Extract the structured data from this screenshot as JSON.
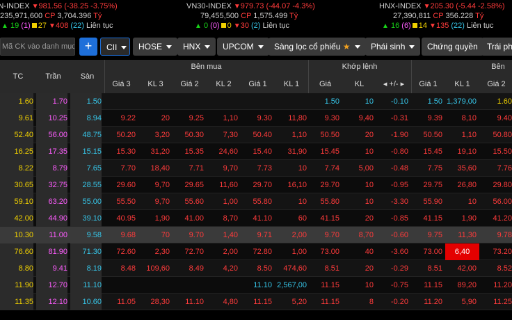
{
  "indices": [
    {
      "name": "VN-INDEX",
      "value": "981.56",
      "change": "(-38.25 -3.75%)",
      "volume": "235,971,600",
      "cp_label": "CP",
      "cp_value": "3,704.396",
      "unit": "Tỷ",
      "up_count": "19",
      "up_ceiling": "(1)",
      "ref_count": "27",
      "down_count": "408",
      "down_floor": "(22)",
      "session": "Liên tục"
    },
    {
      "name": "VN30-INDEX",
      "value": "979.73",
      "change": "(-44.07 -4.3%)",
      "volume": "79,455,500",
      "cp_label": "CP",
      "cp_value": "1,575.499",
      "unit": "Tỷ",
      "up_count": "0",
      "up_ceiling": "(0)",
      "ref_count": "0",
      "down_count": "30",
      "down_floor": "(2)",
      "session": "Liên tục"
    },
    {
      "name": "HNX-INDEX",
      "value": "205.30",
      "change": "(-5.44 -2.58%)",
      "volume": "27,390,811",
      "cp_label": "CP",
      "cp_value": "356.228",
      "unit": "Tỷ",
      "up_count": "16",
      "up_ceiling": "(6)",
      "ref_count": "14",
      "down_count": "135",
      "down_floor": "(22)",
      "session": "Liên tục"
    }
  ],
  "toolbar": {
    "search_placeholder": "Mã CK vào danh mục",
    "add_label": "+",
    "watchlist": "CII",
    "exchanges": [
      "HOSE",
      "HNX",
      "UPCOM"
    ],
    "filter": "Sàng lọc cổ phiếu",
    "derivatives": "Phái sinh",
    "warrants": "Chứng quyền",
    "bonds": "Trái ph"
  },
  "header": {
    "tc": "TC",
    "tran": "Trần",
    "san": "Sàn",
    "buy_group": "Bên mua",
    "match_group": "Khớp lệnh",
    "sell_group": "Bên",
    "buy_cols": [
      "Giá 3",
      "KL 3",
      "Giá 2",
      "KL 2",
      "Giá 1",
      "KL 1"
    ],
    "match_cols": [
      "Giá",
      "KL",
      "+/-"
    ],
    "sell_cols": [
      "Giá 1",
      "KL 1",
      "Giá 2"
    ]
  },
  "rows": [
    {
      "tc": "1.60",
      "tran": "1.70",
      "san": "1.50",
      "g3": "",
      "k3": "",
      "g2": "",
      "k2": "",
      "g1": "",
      "k1": "",
      "mp": "1.50",
      "mk": "10",
      "mc": "-0.10",
      "s1": "1.50",
      "sk1": "1,379,00",
      "s2": "1.60",
      "st": "floor",
      "bc": [
        "",
        "",
        ""
      ],
      "mcls": "floor",
      "sc": [
        "floor",
        "floor",
        "ref"
      ]
    },
    {
      "tc": "9.61",
      "tran": "10.25",
      "san": "8.94",
      "g3": "9.22",
      "k3": "20",
      "g2": "9.25",
      "k2": "1,10",
      "g1": "9.30",
      "k1": "11,80",
      "mp": "9.30",
      "mk": "9,40",
      "mc": "-0.31",
      "s1": "9.39",
      "sk1": "8,10",
      "s2": "9.40",
      "bc": [
        "dn",
        "dn",
        "dn"
      ],
      "mcls": "dn",
      "sc": [
        "dn",
        "dn",
        "dn"
      ]
    },
    {
      "tc": "52.40",
      "tran": "56.00",
      "san": "48.75",
      "g3": "50.20",
      "k3": "3,20",
      "g2": "50.30",
      "k2": "7,30",
      "g1": "50.40",
      "k1": "1,10",
      "mp": "50.50",
      "mk": "20",
      "mc": "-1.90",
      "s1": "50.50",
      "sk1": "1,10",
      "s2": "50.80",
      "bc": [
        "dn",
        "dn",
        "dn"
      ],
      "mcls": "dn",
      "sc": [
        "dn",
        "dn",
        "dn"
      ]
    },
    {
      "tc": "16.25",
      "tran": "17.35",
      "san": "15.15",
      "g3": "15.30",
      "k3": "31,20",
      "g2": "15.35",
      "k2": "24,60",
      "g1": "15.40",
      "k1": "31,90",
      "mp": "15.45",
      "mk": "10",
      "mc": "-0.80",
      "s1": "15.45",
      "sk1": "19,10",
      "s2": "15.50",
      "bc": [
        "dn",
        "dn",
        "dn"
      ],
      "mcls": "dn",
      "sc": [
        "dn",
        "dn",
        "dn"
      ]
    },
    {
      "tc": "8.22",
      "tran": "8.79",
      "san": "7.65",
      "g3": "7.70",
      "k3": "18,40",
      "g2": "7.71",
      "k2": "9,70",
      "g1": "7.73",
      "k1": "10",
      "mp": "7.74",
      "mk": "5,00",
      "mc": "-0.48",
      "s1": "7.75",
      "sk1": "35,60",
      "s2": "7.76",
      "bc": [
        "dn",
        "dn",
        "dn"
      ],
      "mcls": "dn",
      "sc": [
        "dn",
        "dn",
        "dn"
      ]
    },
    {
      "tc": "30.65",
      "tran": "32.75",
      "san": "28.55",
      "g3": "29.60",
      "k3": "9,70",
      "g2": "29.65",
      "k2": "11,60",
      "g1": "29.70",
      "k1": "16,10",
      "mp": "29.70",
      "mk": "10",
      "mc": "-0.95",
      "s1": "29.75",
      "sk1": "26,80",
      "s2": "29.80",
      "bc": [
        "dn",
        "dn",
        "dn"
      ],
      "mcls": "dn",
      "sc": [
        "dn",
        "dn",
        "dn"
      ]
    },
    {
      "tc": "59.10",
      "tran": "63.20",
      "san": "55.00",
      "g3": "55.50",
      "k3": "9,70",
      "g2": "55.60",
      "k2": "1,00",
      "g1": "55.80",
      "k1": "10",
      "mp": "55.80",
      "mk": "10",
      "mc": "-3.30",
      "s1": "55.90",
      "sk1": "10",
      "s2": "56.00",
      "bc": [
        "dn",
        "dn",
        "dn"
      ],
      "mcls": "dn",
      "sc": [
        "dn",
        "dn",
        "dn"
      ]
    },
    {
      "tc": "42.00",
      "tran": "44.90",
      "san": "39.10",
      "g3": "40.95",
      "k3": "1,90",
      "g2": "41.00",
      "k2": "8,70",
      "g1": "41.10",
      "k1": "60",
      "mp": "41.15",
      "mk": "20",
      "mc": "-0.85",
      "s1": "41.15",
      "sk1": "1,90",
      "s2": "41.20",
      "bc": [
        "dn",
        "dn",
        "dn"
      ],
      "mcls": "dn",
      "sc": [
        "dn",
        "dn",
        "dn"
      ]
    },
    {
      "tc": "10.30",
      "tran": "11.00",
      "san": "9.58",
      "g3": "9.68",
      "k3": "70",
      "g2": "9.70",
      "k2": "1,40",
      "g1": "9.71",
      "k1": "2,00",
      "mp": "9.70",
      "mk": "8,70",
      "mc": "-0.60",
      "s1": "9.75",
      "sk1": "11,30",
      "s2": "9.78",
      "bc": [
        "dn",
        "dn",
        "dn"
      ],
      "mcls": "dn",
      "sc": [
        "dn",
        "dn",
        "dn"
      ],
      "gray": true
    },
    {
      "tc": "76.60",
      "tran": "81.90",
      "san": "71.30",
      "g3": "72.60",
      "k3": "2,30",
      "g2": "72.70",
      "k2": "2,00",
      "g1": "72.80",
      "k1": "1,00",
      "mp": "73.00",
      "mk": "40",
      "mc": "-3.60",
      "s1": "73.00",
      "sk1": "6,40",
      "s2": "73.20",
      "bc": [
        "dn",
        "dn",
        "dn"
      ],
      "mcls": "dn",
      "sc": [
        "dn",
        "dn",
        "dn"
      ],
      "hl_sk1": true
    },
    {
      "tc": "8.80",
      "tran": "9.41",
      "san": "8.19",
      "g3": "8.48",
      "k3": "109,60",
      "g2": "8.49",
      "k2": "4,20",
      "g1": "8.50",
      "k1": "474,60",
      "mp": "8.51",
      "mk": "20",
      "mc": "-0.29",
      "s1": "8.51",
      "sk1": "42,00",
      "s2": "8.52",
      "bc": [
        "dn",
        "dn",
        "dn"
      ],
      "mcls": "dn",
      "sc": [
        "dn",
        "dn",
        "dn"
      ]
    },
    {
      "tc": "11.90",
      "tran": "12.70",
      "san": "11.10",
      "g3": "",
      "k3": "",
      "g2": "",
      "k2": "",
      "g1": "11.10",
      "k1": "2,567,00",
      "mp": "11.15",
      "mk": "10",
      "mc": "-0.75",
      "s1": "11.15",
      "sk1": "89,20",
      "s2": "11.20",
      "bc": [
        "",
        "",
        "floor"
      ],
      "mcls": "dn",
      "sc": [
        "dn",
        "dn",
        "dn"
      ]
    },
    {
      "tc": "11.35",
      "tran": "12.10",
      "san": "10.60",
      "g3": "11.05",
      "k3": "28,30",
      "g2": "11.10",
      "k2": "4,80",
      "g1": "11.15",
      "k1": "5,20",
      "mp": "11.15",
      "mk": "8",
      "mc": "-0.20",
      "s1": "11.20",
      "sk1": "5,90",
      "s2": "11.25",
      "bc": [
        "dn",
        "dn",
        "dn"
      ],
      "mcls": "dn",
      "sc": [
        "dn",
        "dn",
        "dn"
      ]
    }
  ],
  "colors": {
    "up": "#18d418",
    "ref": "#f0d000",
    "down": "#ff3b3b",
    "ceiling": "#ff5cff",
    "floor": "#36c5e8",
    "header_bg": "#2a2a2a"
  }
}
